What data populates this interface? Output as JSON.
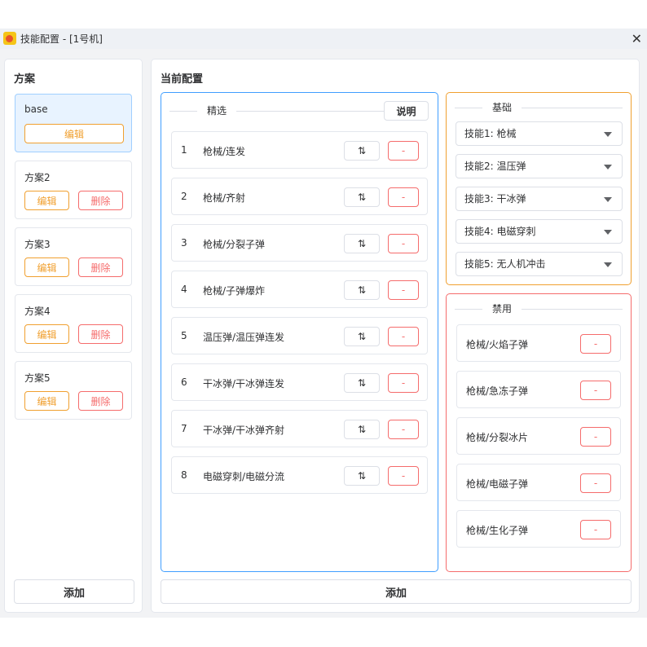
{
  "window": {
    "title": "技能配置 - [1号机]"
  },
  "plans": {
    "title": "方案",
    "edit": "编辑",
    "delete": "删除",
    "add": "添加",
    "items": [
      {
        "name": "base"
      },
      {
        "name": "方案2"
      },
      {
        "name": "方案3"
      },
      {
        "name": "方案4"
      },
      {
        "name": "方案5"
      }
    ]
  },
  "config": {
    "title": "当前配置",
    "add": "添加",
    "selected": {
      "legend": "精选",
      "help": "说明",
      "swap": "⇅",
      "remove": "-",
      "items": [
        {
          "n": "1",
          "t": "枪械/连发"
        },
        {
          "n": "2",
          "t": "枪械/齐射"
        },
        {
          "n": "3",
          "t": "枪械/分裂子弹"
        },
        {
          "n": "4",
          "t": "枪械/子弹爆炸"
        },
        {
          "n": "5",
          "t": "温压弹/温压弹连发"
        },
        {
          "n": "6",
          "t": "干冰弹/干冰弹连发"
        },
        {
          "n": "7",
          "t": "干冰弹/干冰弹齐射"
        },
        {
          "n": "8",
          "t": "电磁穿刺/电磁分流"
        }
      ]
    },
    "basic": {
      "legend": "基础",
      "items": [
        "技能1: 枪械",
        "技能2: 温压弹",
        "技能3: 干冰弹",
        "技能4: 电磁穿刺",
        "技能5: 无人机冲击"
      ]
    },
    "disabled": {
      "legend": "禁用",
      "remove": "-",
      "items": [
        "枪械/火焰子弹",
        "枪械/急冻子弹",
        "枪械/分裂冰片",
        "枪械/电磁子弹",
        "枪械/生化子弹"
      ]
    }
  },
  "colors": {
    "blue": "#409eff",
    "orange": "#f0a030",
    "red": "#f56c6c"
  }
}
